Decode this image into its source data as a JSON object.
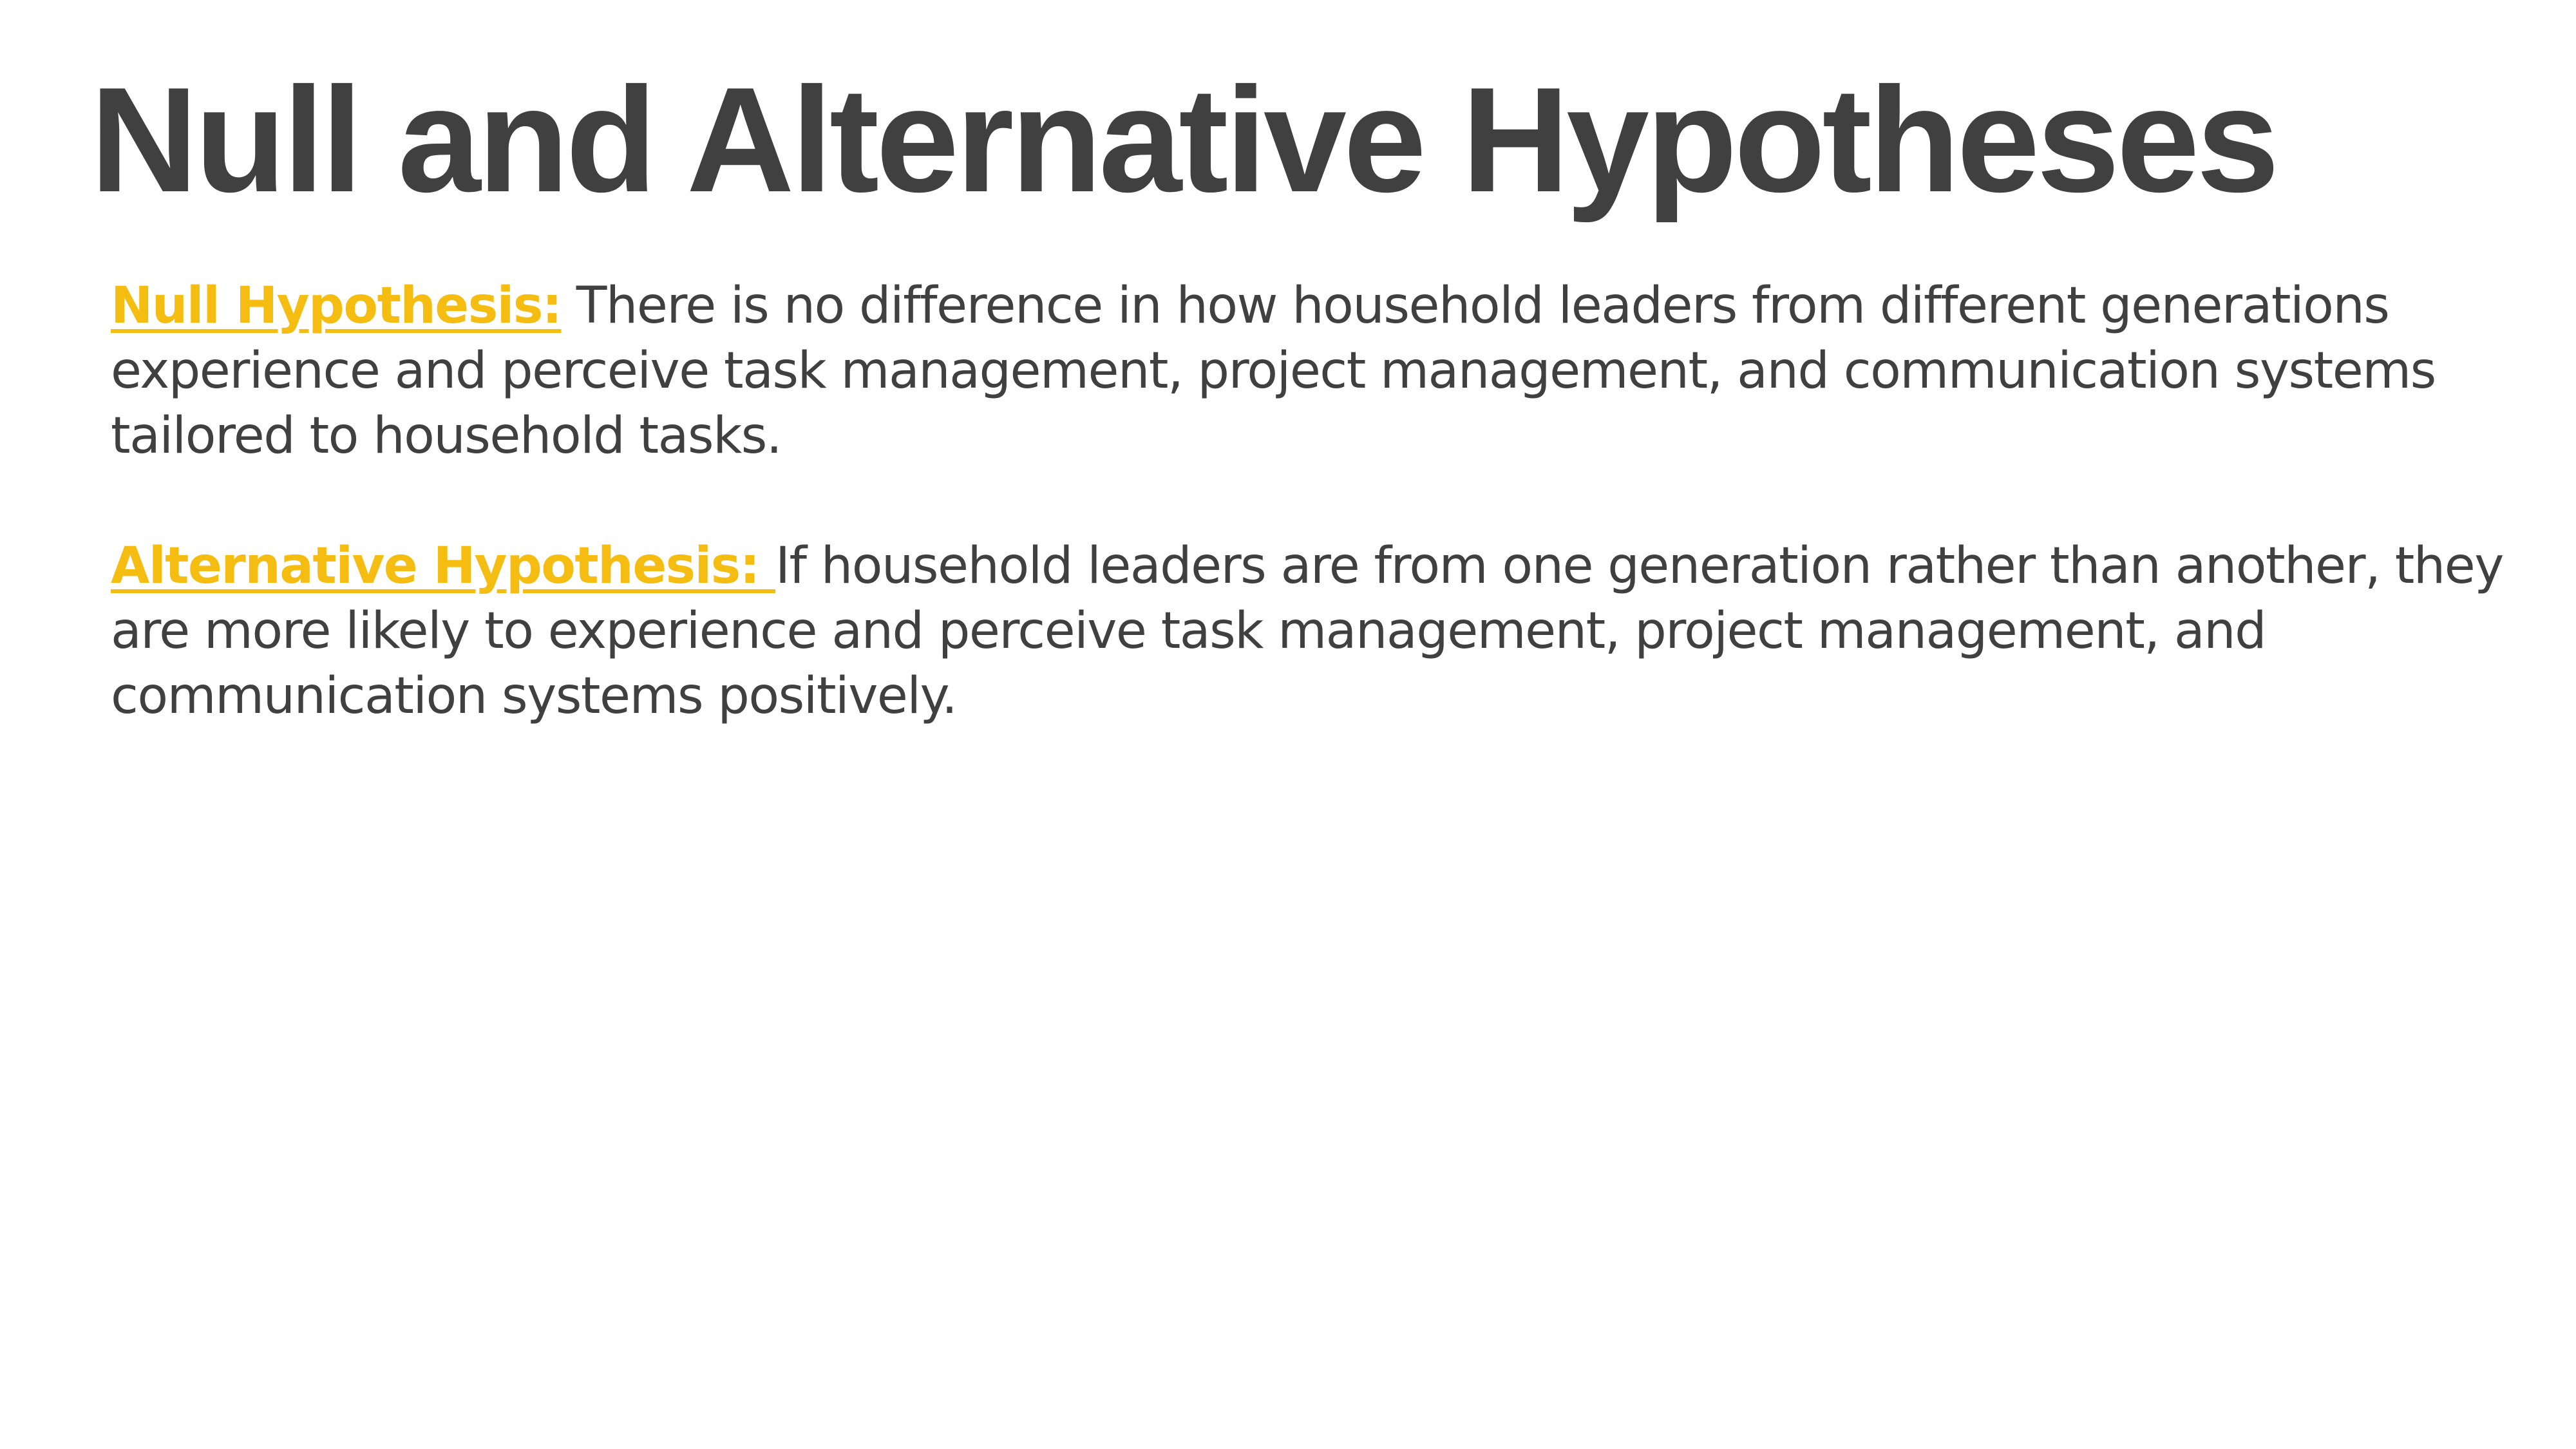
{
  "slide": {
    "title": "Null and Alternative Hypotheses",
    "accent_color": "#f5bd11",
    "text_color": "#404040",
    "paragraphs": [
      {
        "label": "Null Hypothesis:",
        "text": " There is no difference in how household leaders from different generations experience and perceive task management, project management, and communication systems tailored to household tasks."
      },
      {
        "label": "Alternative Hypothesis: ",
        "text": "If household leaders are from one generation rather than another, they are more likely to experience and perceive task management, project management, and communication systems positively."
      }
    ]
  }
}
